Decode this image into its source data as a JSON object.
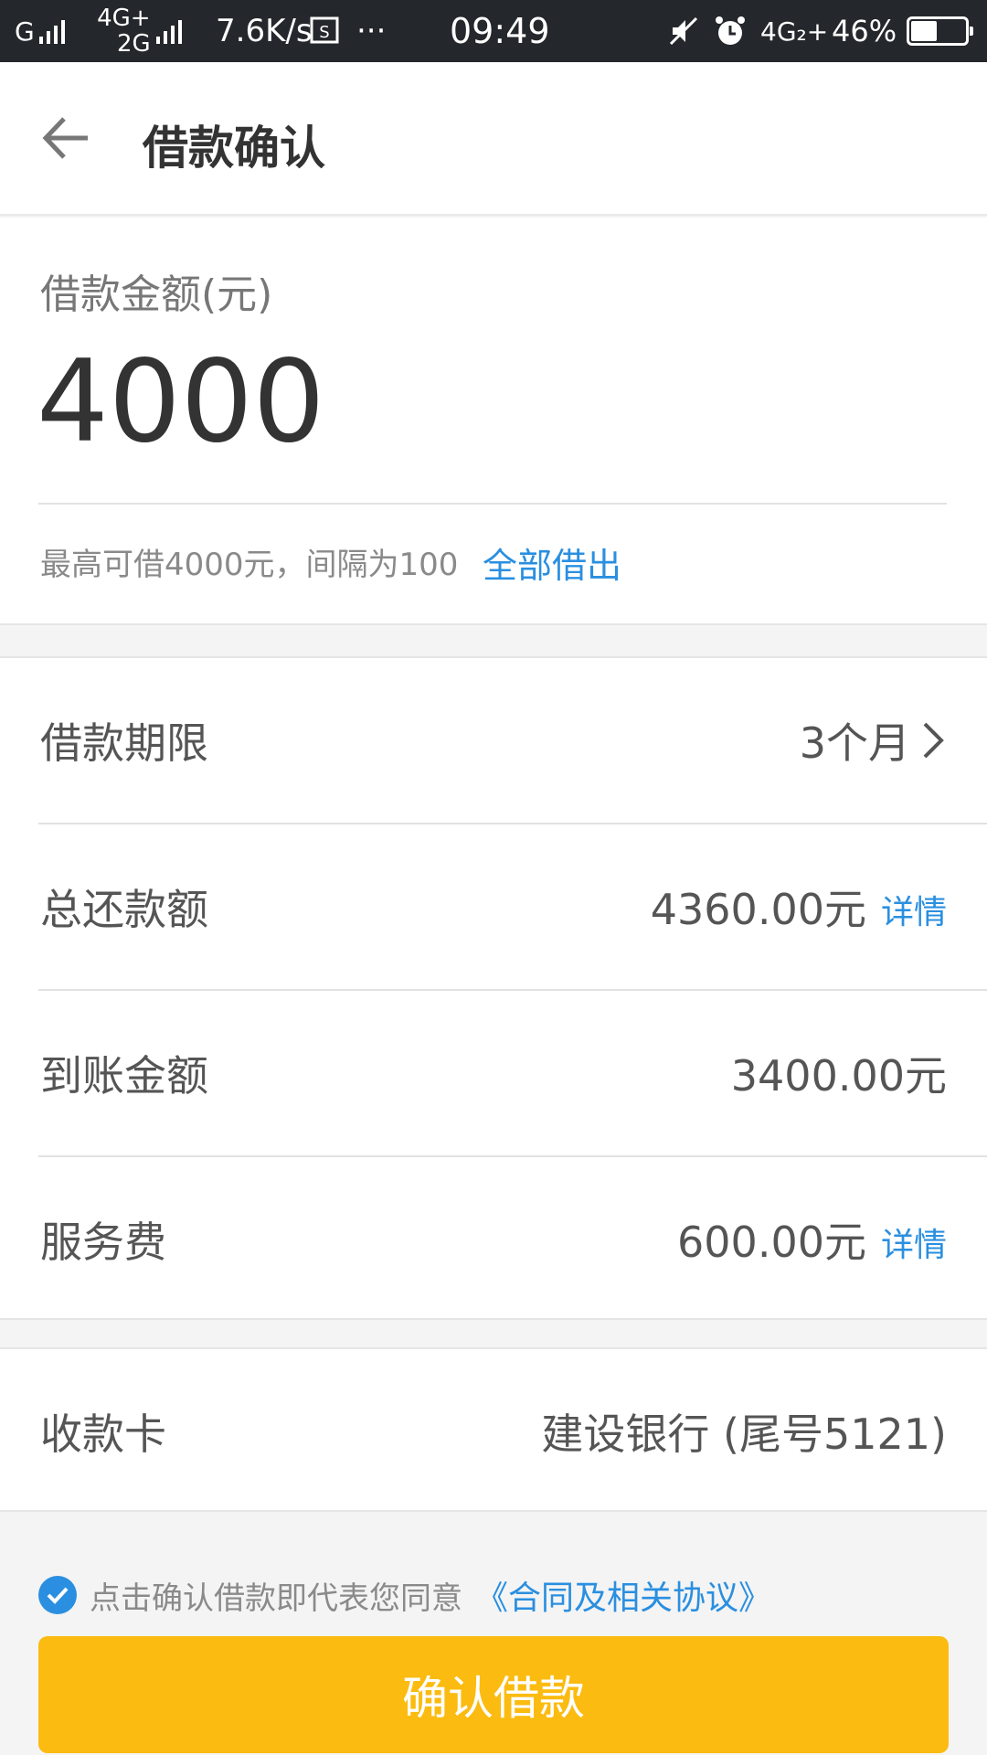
{
  "status_bar": {
    "net1": "G",
    "net2_top": "4G+",
    "net2_bottom": "2G",
    "speed": "7.6K/s",
    "more": "···",
    "time": "09:49",
    "net3": "4G₂+",
    "battery": "46%"
  },
  "header": {
    "title": "借款确认"
  },
  "amount": {
    "label": "借款金额(元)",
    "value": "4000",
    "hint": "最高可借4000元，间隔为100",
    "borrow_all": "全部借出"
  },
  "details": {
    "term": {
      "label": "借款期限",
      "value": "3个月"
    },
    "total_repay": {
      "label": "总还款额",
      "value": "4360.00元",
      "link": "详情"
    },
    "received": {
      "label": "到账金额",
      "value": "3400.00元"
    },
    "service_fee": {
      "label": "服务费",
      "value": "600.00元",
      "link": "详情"
    }
  },
  "card": {
    "label": "收款卡",
    "value": "建设银行 (尾号5121)"
  },
  "agreement": {
    "text": "点击确认借款即代表您同意",
    "link": "《合同及相关协议》"
  },
  "confirm_button": {
    "label": "确认借款"
  },
  "colors": {
    "accent": "#2a8fe0",
    "button": "#fbbb10",
    "status_bar": "#24272b"
  }
}
